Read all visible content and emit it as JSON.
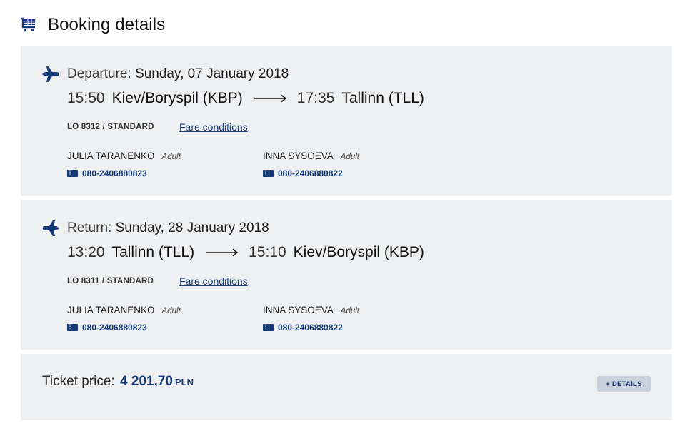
{
  "header": {
    "title": "Booking details",
    "icon": "cart-icon"
  },
  "departure": {
    "label": "Departure:",
    "date": "Sunday, 07 January 2018",
    "dep_time": "15:50",
    "dep_airport": "Kiev/Boryspil (KBP)",
    "arr_time": "17:35",
    "arr_airport": "Tallinn (TLL)",
    "flight": "LO 8312 / STANDARD",
    "fare_link": "Fare conditions",
    "passengers": [
      {
        "name": "JULIA TARANENKO",
        "type": "Adult",
        "ticket": "080-2406880823"
      },
      {
        "name": "INNA SYSOEVA",
        "type": "Adult",
        "ticket": "080-2406880822"
      }
    ]
  },
  "return": {
    "label": "Return:",
    "date": "Sunday, 28 January 2018",
    "dep_time": "13:20",
    "dep_airport": "Tallinn (TLL)",
    "arr_time": "15:10",
    "arr_airport": "Kiev/Boryspil (KBP)",
    "flight": "LO 8311 / STANDARD",
    "fare_link": "Fare conditions",
    "passengers": [
      {
        "name": "JULIA TARANENKO",
        "type": "Adult",
        "ticket": "080-2406880823"
      },
      {
        "name": "INNA SYSOEVA",
        "type": "Adult",
        "ticket": "080-2406880822"
      }
    ]
  },
  "price": {
    "label": "Ticket price:",
    "amount": "4 201,70",
    "currency": "PLN",
    "details_button": "+ DETAILS"
  },
  "colors": {
    "accent": "#163a78",
    "panel_bg": "#eff0f2",
    "button_bg": "#c9d1dc"
  }
}
